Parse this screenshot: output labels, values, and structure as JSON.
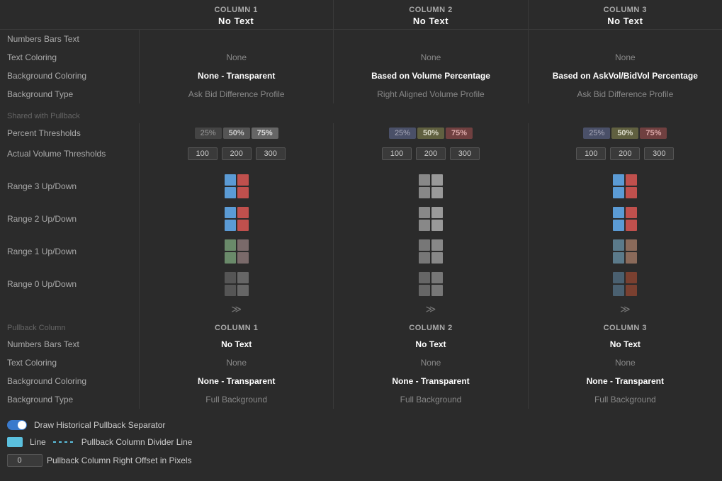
{
  "columns": {
    "labels": {
      "col1": "COLUMN 1",
      "col2": "COLUMN 2",
      "col3": "COLUMN 3"
    }
  },
  "rows": {
    "numbers_bars_text": "Numbers Bars Text",
    "text_coloring": "Text Coloring",
    "background_coloring": "Background Coloring",
    "background_type": "Background Type",
    "shared_with_pullback": "Shared with Pullback",
    "percent_thresholds": "Percent Thresholds",
    "actual_volume_thresholds": "Actual Volume Thresholds",
    "range3": "Range 3 Up/Down",
    "range2": "Range 2 Up/Down",
    "range1": "Range 1 Up/Down",
    "range0": "Range 0 Up/Down",
    "pullback_column": "Pullback Column",
    "pullback_numbers": "Numbers Bars Text",
    "pullback_text": "Text Coloring",
    "pullback_bg": "Background Coloring",
    "pullback_bgtype": "Background Type"
  },
  "col1": {
    "numbers_bars_text": "No Text",
    "text_coloring": "None",
    "background_coloring": "None - Transparent",
    "background_type": "Ask Bid Difference Profile",
    "pct": [
      "25%",
      "50%",
      "75%"
    ],
    "vol": [
      "100",
      "200",
      "300"
    ]
  },
  "col2": {
    "numbers_bars_text": "No Text",
    "text_coloring": "None",
    "background_coloring": "Based on Volume Percentage",
    "background_type": "Right Aligned Volume Profile",
    "pct": [
      "25%",
      "50%",
      "75%"
    ],
    "vol": [
      "100",
      "200",
      "300"
    ]
  },
  "col3": {
    "numbers_bars_text": "No Text",
    "text_coloring": "None",
    "background_coloring": "Based on AskVol/BidVol Percentage",
    "background_type": "Ask Bid Difference Profile",
    "pct": [
      "25%",
      "50%",
      "75%"
    ],
    "vol": [
      "100",
      "200",
      "300"
    ]
  },
  "pullback": {
    "col1": {
      "header": "COLUMN 1",
      "numbers": "No Text",
      "text_coloring": "None",
      "bg_coloring": "None - Transparent",
      "bg_type": "Full Background"
    },
    "col2": {
      "header": "COLUMN 2",
      "numbers": "No Text",
      "text_coloring": "None",
      "bg_coloring": "None - Transparent",
      "bg_type": "Full Background"
    },
    "col3": {
      "header": "COLUMN 3",
      "numbers": "No Text",
      "text_coloring": "None",
      "bg_coloring": "None - Transparent",
      "bg_type": "Full Background"
    }
  },
  "bottom": {
    "draw_separator": "Draw Historical Pullback Separator",
    "line_label": "Line",
    "divider_label": "Pullback Column Divider Line",
    "offset_label": "Pullback Column Right Offset in Pixels"
  },
  "swatches": {
    "col1": {
      "r3": [
        "#5b9bd5",
        "#c0504d",
        "#5b9bd5",
        "#c0504d"
      ],
      "r2": [
        "#5b9bd5",
        "#c0504d",
        "#5b9bd5",
        "#c0504d"
      ],
      "r1": [
        "#888",
        "#888",
        "#888",
        "#888"
      ],
      "r0": [
        "#666",
        "#666",
        "#666",
        "#666"
      ]
    },
    "col2": {
      "r3": [
        "#888",
        "#888",
        "#888",
        "#888"
      ],
      "r2": [
        "#888",
        "#888",
        "#888",
        "#888"
      ],
      "r1": [
        "#666",
        "#666",
        "#666",
        "#666"
      ],
      "r0": [
        "#555",
        "#555",
        "#555",
        "#555"
      ]
    },
    "col3": {
      "r3": [
        "#5b9bd5",
        "#c0504d",
        "#5b9bd5",
        "#c0504d"
      ],
      "r2": [
        "#5b9bd5",
        "#c0504d",
        "#5b9bd5",
        "#c0504d"
      ],
      "r1": [
        "#888",
        "#888",
        "#888",
        "#888"
      ],
      "r0": [
        "#5b6a7a",
        "#7a4a3a",
        "#5b6a7a",
        "#7a4a3a"
      ]
    }
  }
}
